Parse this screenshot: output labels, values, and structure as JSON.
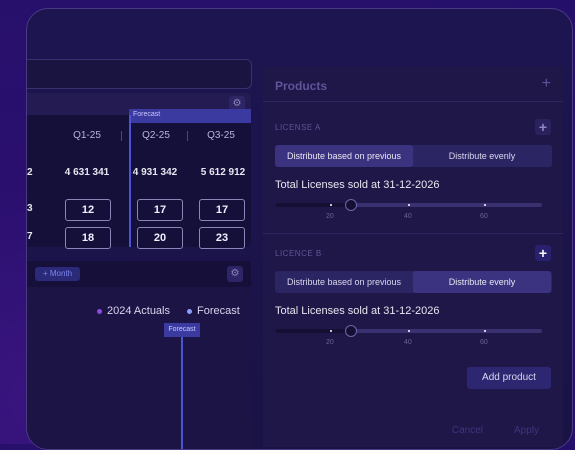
{
  "header": {
    "ghost_text": ""
  },
  "table": {
    "forecast_label": "Forecast",
    "columns": [
      "Q1-25",
      "Q2-25",
      "Q3-25"
    ],
    "totals": [
      "4 631 341",
      "4 931 342",
      "5 612 912"
    ],
    "edge_values": [
      "2",
      "3",
      "7"
    ],
    "rows": [
      [
        "12",
        "17",
        "17"
      ],
      [
        "18",
        "20",
        "23"
      ]
    ]
  },
  "chart": {
    "month_label": "+ Month",
    "legend": [
      {
        "label": "2024 Actuals",
        "color": "#8e4ad8"
      },
      {
        "label": "Forecast",
        "color": "#8e9df8"
      }
    ],
    "forecast_label": "Forecast"
  },
  "panel": {
    "title": "Products",
    "add_label": "+",
    "licenses": [
      {
        "label": "LICENSE A",
        "option_previous": "Distribute based on previous",
        "option_evenly": "Distribute evenly",
        "active": "previous",
        "total_label": "Total Licenses sold at 31-12-2026",
        "slider_value": 30,
        "ticks": [
          "20",
          "40",
          "60"
        ]
      },
      {
        "label": "LICENCE B",
        "option_previous": "Distribute based on previous",
        "option_evenly": "Distribute evenly",
        "active": "evenly",
        "total_label": "Total Licenses sold at 31-12-2026",
        "slider_value": 30,
        "ticks": [
          "20",
          "40",
          "60"
        ]
      }
    ],
    "add_product_label": "Add product",
    "cancel_label": "Cancel",
    "apply_label": "Apply"
  }
}
